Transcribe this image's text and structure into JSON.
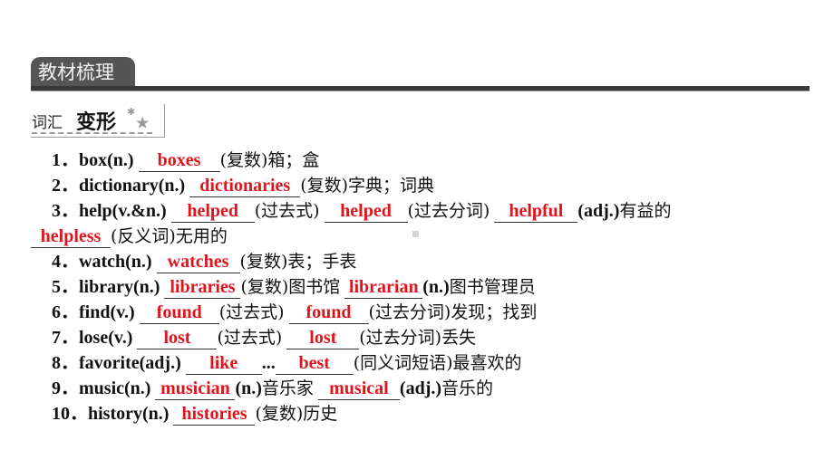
{
  "header": {
    "tab_title": "教材梳理",
    "section_prefix": "词汇",
    "section_title": "变形",
    "section_icon": "star-icon"
  },
  "items": [
    {
      "num": "1．",
      "word": "box(n.)",
      "parts": [
        {
          "type": "blank",
          "answer": "boxes"
        },
        {
          "type": "text",
          "text": "(复数)箱；盒"
        }
      ]
    },
    {
      "num": "2．",
      "word": "dictionary(n.)",
      "parts": [
        {
          "type": "blank",
          "answer": "dictionaries"
        },
        {
          "type": "text",
          "text": "(复数)字典；词典"
        }
      ]
    },
    {
      "num": "3．",
      "word": "help(v.&n.)",
      "parts": [
        {
          "type": "blank",
          "answer": "helped"
        },
        {
          "type": "text",
          "text": "(过去式)"
        },
        {
          "type": "blank",
          "answer": "helped"
        },
        {
          "type": "text",
          "text": "(过去分词)"
        },
        {
          "type": "blank",
          "answer": "helpful"
        },
        {
          "type": "bold",
          "text": "(adj.)"
        },
        {
          "type": "text",
          "text": "有益的"
        }
      ]
    },
    {
      "num": "",
      "word": "",
      "parts": [
        {
          "type": "blank",
          "answer": "helpless"
        },
        {
          "type": "text",
          "text": "(反义词)无用的"
        }
      ]
    },
    {
      "num": "4．",
      "word": "watch(n.)",
      "parts": [
        {
          "type": "blank",
          "answer": "watches"
        },
        {
          "type": "text",
          "text": "(复数)表；手表"
        }
      ]
    },
    {
      "num": "5．",
      "word": "library(n.)",
      "parts": [
        {
          "type": "blank",
          "answer": "libraries"
        },
        {
          "type": "text",
          "text": "(复数)图书馆"
        },
        {
          "type": "blank",
          "answer": "librarian"
        },
        {
          "type": "bold",
          "text": "(n.)"
        },
        {
          "type": "text",
          "text": "图书管理员"
        }
      ]
    },
    {
      "num": "6．",
      "word": "find(v.)",
      "parts": [
        {
          "type": "blank",
          "answer": "found"
        },
        {
          "type": "text",
          "text": "(过去式)"
        },
        {
          "type": "blank",
          "answer": "found"
        },
        {
          "type": "text",
          "text": "(过去分词)发现；找到"
        }
      ]
    },
    {
      "num": "7．",
      "word": "lose(v.)",
      "parts": [
        {
          "type": "blank",
          "answer": "lost"
        },
        {
          "type": "text",
          "text": "(过去式)"
        },
        {
          "type": "blank",
          "answer": "lost"
        },
        {
          "type": "text",
          "text": "(过去分词)丢失"
        }
      ]
    },
    {
      "num": "8．",
      "word": "favorite(adj.)",
      "parts": [
        {
          "type": "blank",
          "answer": "like"
        },
        {
          "type": "bold",
          "text": "..."
        },
        {
          "type": "blank",
          "answer": "best"
        },
        {
          "type": "text",
          "text": "(同义词短语)最喜欢的"
        }
      ]
    },
    {
      "num": "9．",
      "word": "music(n.)",
      "parts": [
        {
          "type": "blank",
          "answer": "musician"
        },
        {
          "type": "bold",
          "text": "(n.)"
        },
        {
          "type": "text",
          "text": "音乐家"
        },
        {
          "type": "blank",
          "answer": "musical"
        },
        {
          "type": "bold",
          "text": "(adj.)"
        },
        {
          "type": "text",
          "text": "音乐的"
        }
      ]
    },
    {
      "num": "10．",
      "word": "history(n.)",
      "parts": [
        {
          "type": "blank",
          "answer": "histories"
        },
        {
          "type": "text",
          "text": "(复数)历史"
        }
      ]
    }
  ],
  "colors": {
    "answer": "#e0141c",
    "tab_bg": "#555555"
  }
}
